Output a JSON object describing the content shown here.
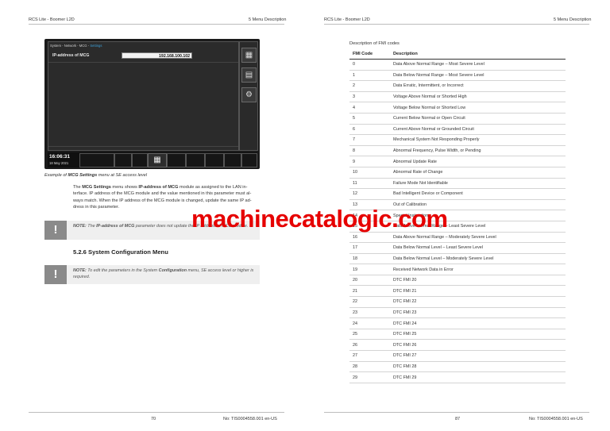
{
  "header": {
    "left_doc": "RCS Lite - Boomer L2D",
    "left_section": "5 Menu Description",
    "right_doc": "RCS Lite - Boomer L2D",
    "right_section": "5 Menu Description"
  },
  "screen": {
    "breadcrumb": [
      "System",
      "Network",
      "MCG",
      "Settings"
    ],
    "breadcrumb_sep": " - ",
    "ip_label": "IP-address of MCG",
    "ip_value": "192.168.100.102",
    "time": "16:06:31",
    "date": "18 May 2021",
    "side_icons": [
      "network-icon",
      "service-icon",
      "settings-icon"
    ],
    "accent": "#3fa1d8"
  },
  "caption": {
    "prefix": "Example of ",
    "bold": "MCG Settings",
    "suffix": " menu at SE access level"
  },
  "paragraph": {
    "t1": "The ",
    "b1": "MCG Settings",
    "t2": " menu shows ",
    "b2": "IP-address of MCG",
    "t3": " module as assigned to the LAN in-terface. IP address of the MCG module and the value mentioned in this parameter must al-ways match. When the IP address of the MCG module is changed, update the same IP ad-dress in this parameter."
  },
  "note1": {
    "label": "NOTE:",
    "t1": " The ",
    "bold": "IP-address of MCG",
    "t2": " parameter does not update the IP address of MCG module."
  },
  "section_heading": "5.2.6 System Configuration Menu",
  "note2": {
    "label": "NOTE:",
    "t1": " To edit the parameters in the System ",
    "bold": "Configuration",
    "t2": " menu, SE access level or higher is required."
  },
  "note_icon": "!",
  "table": {
    "caption": "Description of FMI codes",
    "headers": [
      "FMI Code",
      "Description"
    ],
    "rows": [
      [
        "0",
        "Data Above Normal Range – Most Severe Level"
      ],
      [
        "1",
        "Data Below Normal Range – Most Severe Level"
      ],
      [
        "2",
        "Data Erratic, Intermittent, or Incorrect"
      ],
      [
        "3",
        "Voltage Above Normal or Shorted High"
      ],
      [
        "4",
        "Voltage Below Normal or Shorted Low"
      ],
      [
        "5",
        "Current Below Normal or Open Circuit"
      ],
      [
        "6",
        "Current Above Normal or Grounded Circuit"
      ],
      [
        "7",
        "Mechanical System Not Responding Properly"
      ],
      [
        "8",
        "Abnormal Frequency, Pulse Width, or Pending"
      ],
      [
        "9",
        "Abnormal Update Rate"
      ],
      [
        "10",
        "Abnormal Rate of Change"
      ],
      [
        "11",
        "Failure Mode Not Identifiable"
      ],
      [
        "12",
        "Bad Intelligent Device or Component"
      ],
      [
        "13",
        "Out of Calibration"
      ],
      [
        "14",
        "Special Instructions"
      ],
      [
        "15",
        "Data Above Normal Range – Least Severe Level"
      ],
      [
        "16",
        "Data Above Normal Range – Moderately Severe Level"
      ],
      [
        "17",
        "Data Below Normal Level – Least Severe Level"
      ],
      [
        "18",
        "Data Below Normal Level – Moderately Severe Level"
      ],
      [
        "19",
        "Received Network Data in Error"
      ],
      [
        "20",
        "DTC FMI 20"
      ],
      [
        "21",
        "DTC FMI 21"
      ],
      [
        "22",
        "DTC FMI 22"
      ],
      [
        "23",
        "DTC FMI 23"
      ],
      [
        "24",
        "DTC FMI 24"
      ],
      [
        "25",
        "DTC FMI 25"
      ],
      [
        "26",
        "DTC FMI 26"
      ],
      [
        "27",
        "DTC FMI 27"
      ],
      [
        "28",
        "DTC FMI 28"
      ],
      [
        "29",
        "DTC FMI 29"
      ]
    ]
  },
  "footer": {
    "left_page": "70",
    "left_doc_no": "No: TIS0004558.001 en-US",
    "right_page": "87",
    "right_doc_no": "No: TIS0004558.001 en-US"
  },
  "watermark": "machinecatalogic.com"
}
